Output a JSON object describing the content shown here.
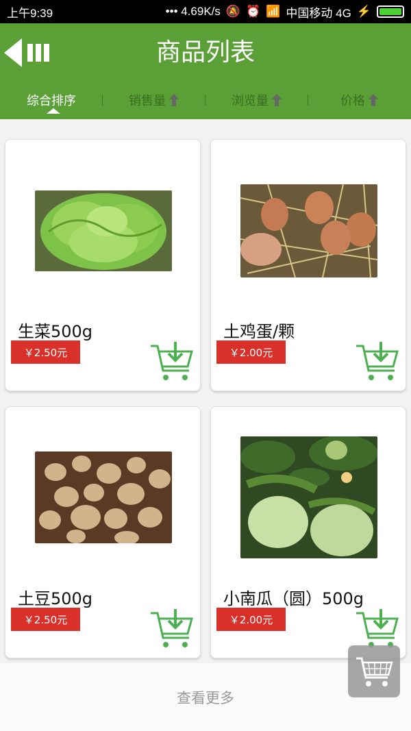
{
  "status_bar": {
    "time": "上午9:39",
    "speed": "4.69K/s",
    "carrier": "中国移动 4G"
  },
  "header": {
    "title": "商品列表",
    "sort_tabs": [
      {
        "label": "综合排序",
        "active": true
      },
      {
        "label": "销售量",
        "active": false
      },
      {
        "label": "浏览量",
        "active": false
      },
      {
        "label": "价格",
        "active": false
      }
    ]
  },
  "products": [
    {
      "name": "生菜500g",
      "price": "￥2.50元",
      "image": "lettuce-photo"
    },
    {
      "name": "土鸡蛋/颗",
      "price": "￥2.00元",
      "image": "eggs-photo"
    },
    {
      "name": "土豆500g",
      "price": "￥2.50元",
      "image": "potatoes-photo"
    },
    {
      "name": "小南瓜（圆）500g",
      "price": "￥2.00元",
      "image": "round-pumpkin-photo"
    }
  ],
  "footer": {
    "load_more": "查看更多"
  },
  "colors": {
    "header_green": "#5aa036",
    "price_red": "#d9312a",
    "cart_green": "#4caf50"
  }
}
